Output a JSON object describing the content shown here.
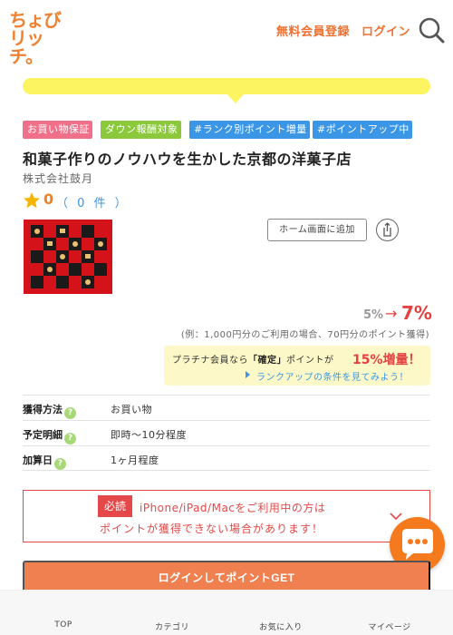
{
  "header": {
    "logo_line1": "ちょび",
    "logo_line2": "リッチ。",
    "register_label": "無料会員登録",
    "login_label": "ログイン",
    "search_icon": "search-icon"
  },
  "tags": [
    "お買い物保証",
    "ダウン報酬対象",
    "#ランク別ポイント増量",
    "#ポイントアップ中"
  ],
  "shop": {
    "title": "和菓子作りのノウハウを生かした京都の洋菓子店",
    "company": "株式会社鼓月",
    "rating_score": "0",
    "rating_count": "（ 0 件 ）"
  },
  "actions": {
    "home_button": "ホーム画面に追加",
    "share_icon": "share-icon"
  },
  "point_rate": {
    "old": "5%",
    "arrow": "→",
    "new": "7%",
    "example": "(例：1,000円分のご利用の場合、70円分のポイント獲得)"
  },
  "platinum": {
    "prefix": "プラチナ会員なら",
    "highlight": "「確定」",
    "suffix": "ポイントが",
    "boost": "15%増量！",
    "link": "ランクアップの条件を見てみよう！"
  },
  "info": [
    {
      "label": "獲得方法",
      "value": "お買い物"
    },
    {
      "label": "予定明細",
      "value": "即時～10分程度"
    },
    {
      "label": "加算日",
      "value": "1ヶ月程度"
    }
  ],
  "help_glyph": "?",
  "warning": {
    "badge": "必読",
    "line1": "iPhone/iPad/Macをご利用中の方は",
    "line2": "ポイントが獲得できない場合があります！"
  },
  "cta_label": "ログインしてポイントGET",
  "bottom_nav": [
    "TOP",
    "カテゴリ",
    "お気に入り",
    "マイページ"
  ],
  "colors": {
    "brand_orange": "#f08030",
    "accent_red": "#e64040",
    "link_blue": "#3c96e6",
    "notice_yellow": "#fcf460"
  }
}
